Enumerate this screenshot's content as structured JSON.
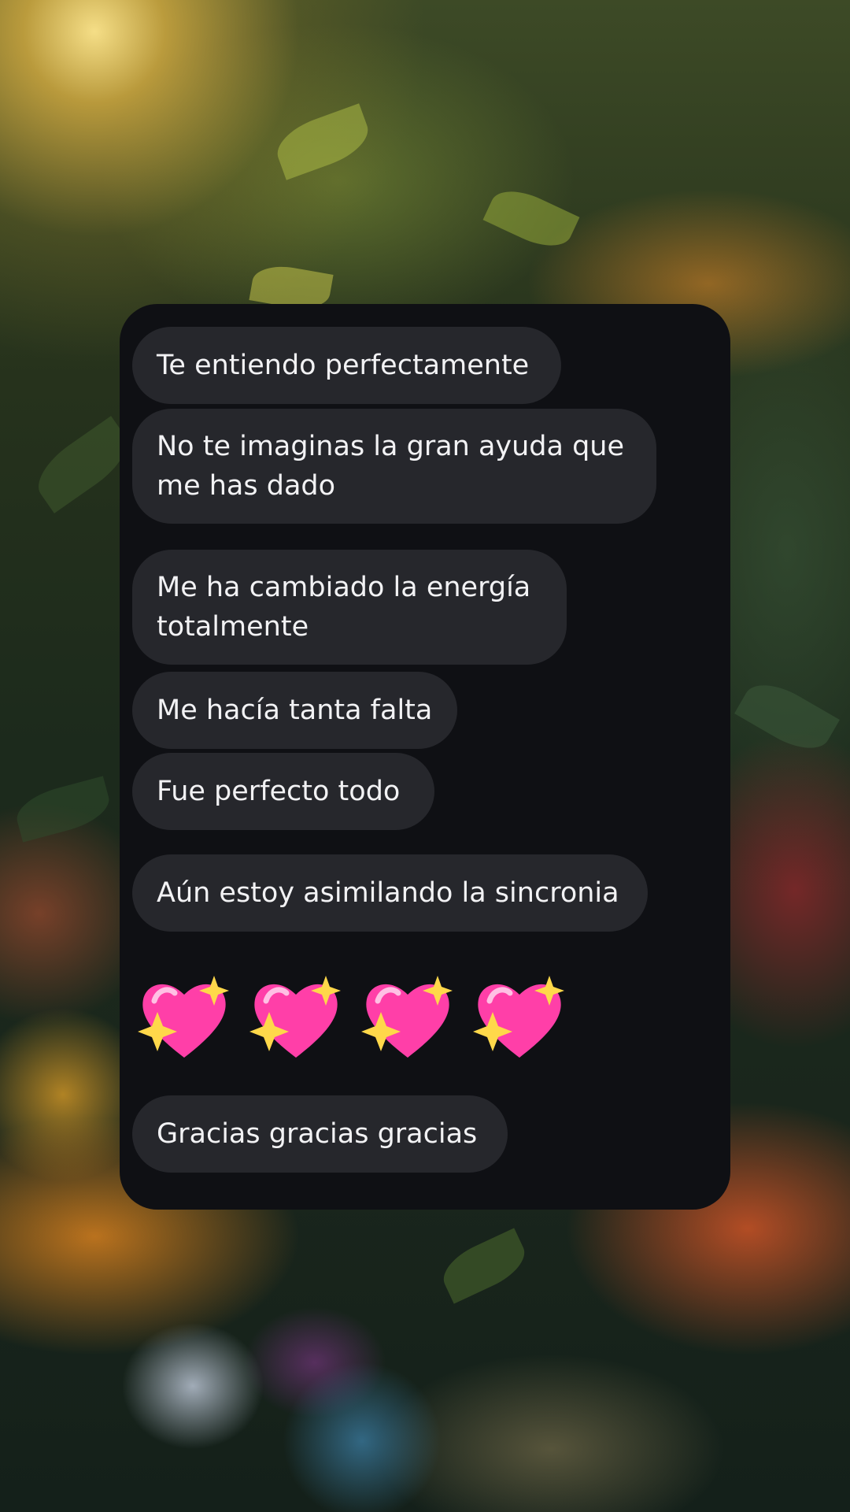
{
  "messages": [
    "Te entiendo perfectamente",
    "No te imaginas la gran ayuda que me has dado",
    "Me ha cambiado la energía totalmente",
    "Me hacía tanta falta",
    "Fue perfecto todo",
    "Aún estoy asimilando la sincronia",
    "💖💖💖💖",
    "Gracias gracias gracias"
  ],
  "emoji": {
    "name": "sparkling-heart-icon",
    "count": 4
  },
  "colors": {
    "panel": "#0f1014",
    "bubble": "#26272c",
    "text": "#f2f2f4",
    "heart": "#ff3fa8"
  }
}
